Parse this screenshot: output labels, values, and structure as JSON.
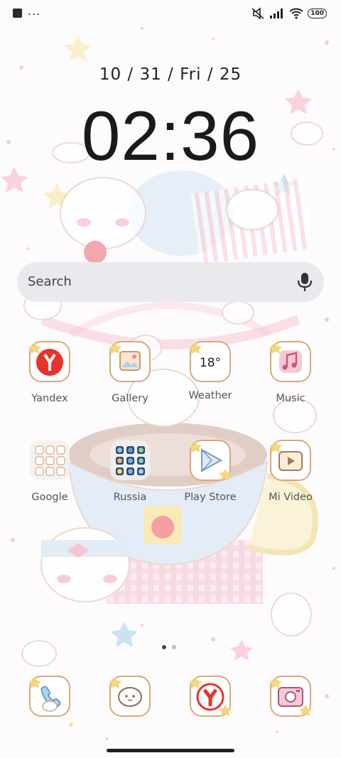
{
  "status_bar": {
    "battery": "100",
    "signal_icon": "signal-icon",
    "wifi_icon": "wifi-icon",
    "silent_icon": "silent-icon",
    "overflow": "..."
  },
  "lock": {
    "date": "10 / 31 / Fri / 25",
    "time": "02:36"
  },
  "search": {
    "placeholder": "Search",
    "mic_icon": "mic-icon"
  },
  "apps_row1": [
    {
      "label": "Yandex",
      "icon": "yandex-icon"
    },
    {
      "label": "Gallery",
      "icon": "gallery-icon"
    },
    {
      "label": "Weather",
      "icon": "weather-icon",
      "badge": "18°"
    },
    {
      "label": "Music",
      "icon": "music-icon"
    }
  ],
  "apps_row2": [
    {
      "label": "Google",
      "icon": "google-folder-icon"
    },
    {
      "label": "Russia",
      "icon": "russia-folder-icon"
    },
    {
      "label": "Play Store",
      "icon": "play-store-icon"
    },
    {
      "label": "Mi Video",
      "icon": "mi-video-icon"
    }
  ],
  "dock": [
    {
      "icon": "phone-icon"
    },
    {
      "icon": "messages-icon"
    },
    {
      "icon": "yandex-browser-icon"
    },
    {
      "icon": "camera-icon"
    }
  ],
  "page_indicator": {
    "pages": 2,
    "active": 1
  },
  "colors": {
    "accent_yellow": "#f3d77a",
    "icon_border": "#d8a87a",
    "dot_active": "#444444",
    "dot_inactive": "#bbbbbb"
  }
}
